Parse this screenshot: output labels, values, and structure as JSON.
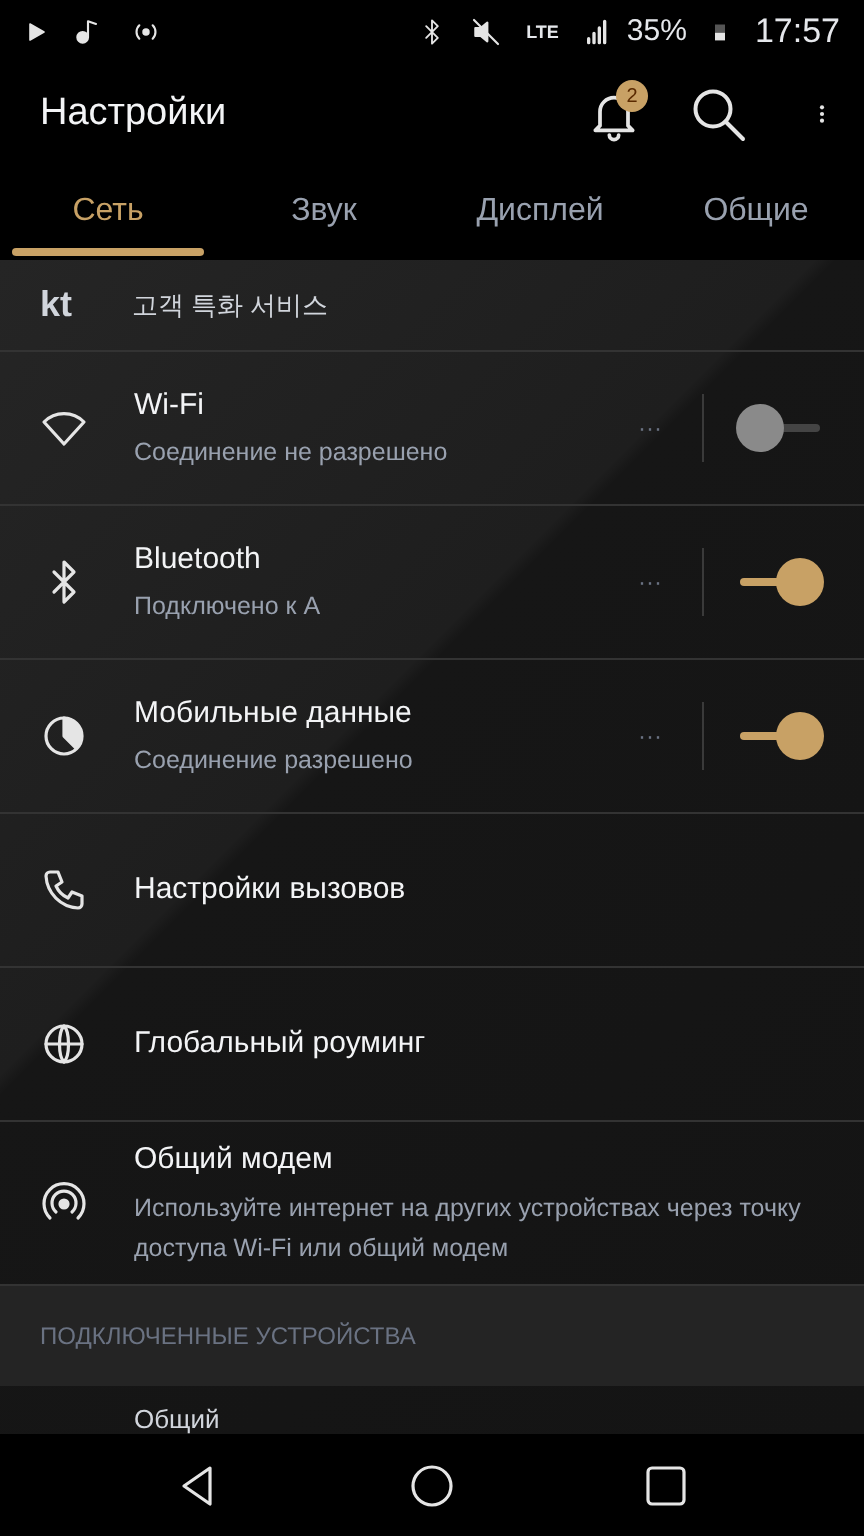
{
  "status_bar": {
    "network": "LTE",
    "battery": "35%",
    "time": "17:57"
  },
  "toolbar": {
    "title": "Настройки",
    "notification_count": "2"
  },
  "tabs": [
    {
      "label": "Сеть",
      "selected": true
    },
    {
      "label": "Звук",
      "selected": false
    },
    {
      "label": "Дисплей",
      "selected": false
    },
    {
      "label": "Общие",
      "selected": false
    }
  ],
  "items": [
    {
      "kind": "carrier",
      "logo": "kt",
      "title": "고객 특화 서비스"
    },
    {
      "kind": "toggle",
      "title": "Wi-Fi",
      "subtitle": "Соединение не разрешено",
      "more": "···",
      "on": false
    },
    {
      "kind": "toggle",
      "title": "Bluetooth",
      "subtitle": "Подключено к A",
      "more": "···",
      "on": true
    },
    {
      "kind": "toggle",
      "title": "Мобильные данные",
      "subtitle": "Соединение разрешено",
      "more": "···",
      "on": true
    },
    {
      "kind": "plain",
      "title": "Настройки вызовов"
    },
    {
      "kind": "plain",
      "title": "Глобальный роуминг"
    },
    {
      "kind": "plain",
      "title": "Общий модем",
      "subtitle": "Используйте интернет на других устройствах через точку доступа Wi-Fi или общий модем"
    }
  ],
  "section": {
    "header": "ПОДКЛЮЧЕННЫЕ УСТРОЙСТВА",
    "next_item": "Общий"
  }
}
